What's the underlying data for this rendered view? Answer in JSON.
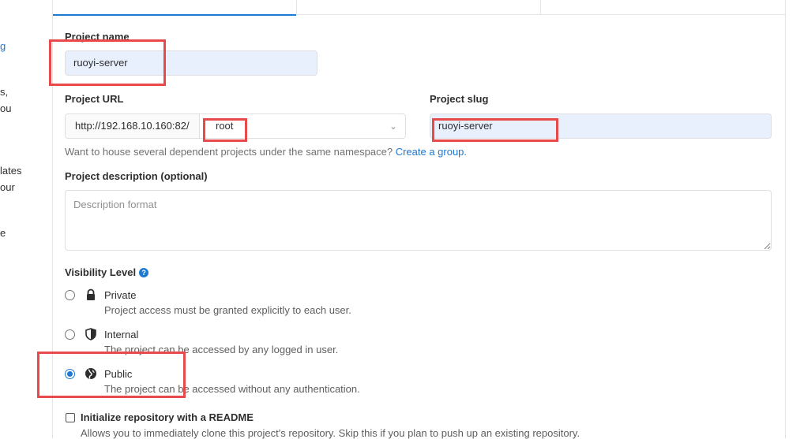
{
  "sidebar_fragments": [
    "g",
    "s,",
    "ou",
    "lates",
    "our",
    "e"
  ],
  "form": {
    "project_name": {
      "label": "Project name",
      "value": "ruoyi-server"
    },
    "project_url": {
      "label": "Project URL",
      "prefix": "http://192.168.10.160:82/",
      "namespace": "root"
    },
    "project_slug": {
      "label": "Project slug",
      "value": "ruoyi-server"
    },
    "namespace_help": {
      "text": "Want to house several dependent projects under the same namespace?",
      "link": "Create a group."
    },
    "description": {
      "label": "Project description (optional)",
      "placeholder": "Description format"
    },
    "visibility": {
      "label": "Visibility Level",
      "help_icon": "question-circle-icon",
      "options": [
        {
          "title": "Private",
          "desc": "Project access must be granted explicitly to each user.",
          "icon": "lock-icon",
          "checked": false
        },
        {
          "title": "Internal",
          "desc": "The project can be accessed by any logged in user.",
          "icon": "shield-icon",
          "checked": false
        },
        {
          "title": "Public",
          "desc": "The project can be accessed without any authentication.",
          "icon": "globe-icon",
          "checked": true
        }
      ]
    },
    "readme": {
      "label": "Initialize repository with a README",
      "desc": "Allows you to immediately clone this project's repository. Skip this if you plan to push up an existing repository."
    }
  },
  "colors": {
    "accent": "#1f78d1",
    "annotation": "#e8494b",
    "autofill": "#e8f0fe"
  }
}
